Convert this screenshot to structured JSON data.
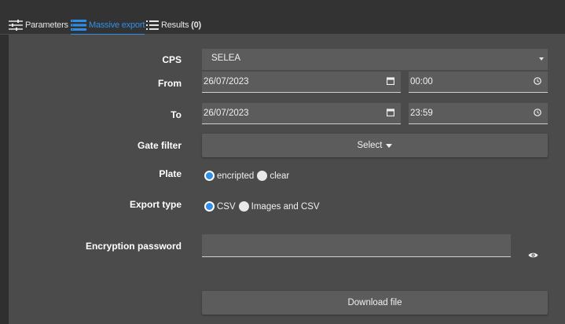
{
  "tabs": [
    {
      "label": "Parameters",
      "icon": "sliders-icon",
      "active": false
    },
    {
      "label": "Massive export",
      "icon": "list-stack-icon",
      "active": true
    },
    {
      "label": "Results ",
      "count": "(0)",
      "icon": "list-icon",
      "active": false
    }
  ],
  "form": {
    "cps": {
      "label": "CPS",
      "value": "SELEA"
    },
    "from": {
      "label": "From",
      "date": "26/07/2023",
      "time": "00:00"
    },
    "to": {
      "label": "To",
      "date": "26/07/2023",
      "time": "23:59"
    },
    "gate_filter": {
      "label": "Gate filter",
      "button": "Select"
    },
    "plate": {
      "label": "Plate",
      "options": [
        "encripted",
        "clear"
      ],
      "selected": "encripted"
    },
    "export_type": {
      "label": "Export type",
      "options": [
        "CSV",
        "Images and CSV"
      ],
      "selected": "CSV"
    },
    "encryption_password": {
      "label": "Encryption password",
      "value": ""
    },
    "download_label": "Download file"
  },
  "colors": {
    "accent": "#2f8fe8",
    "panel": "#4b4b4b",
    "field": "#5c5c5c",
    "background": "#2f2f2f"
  }
}
